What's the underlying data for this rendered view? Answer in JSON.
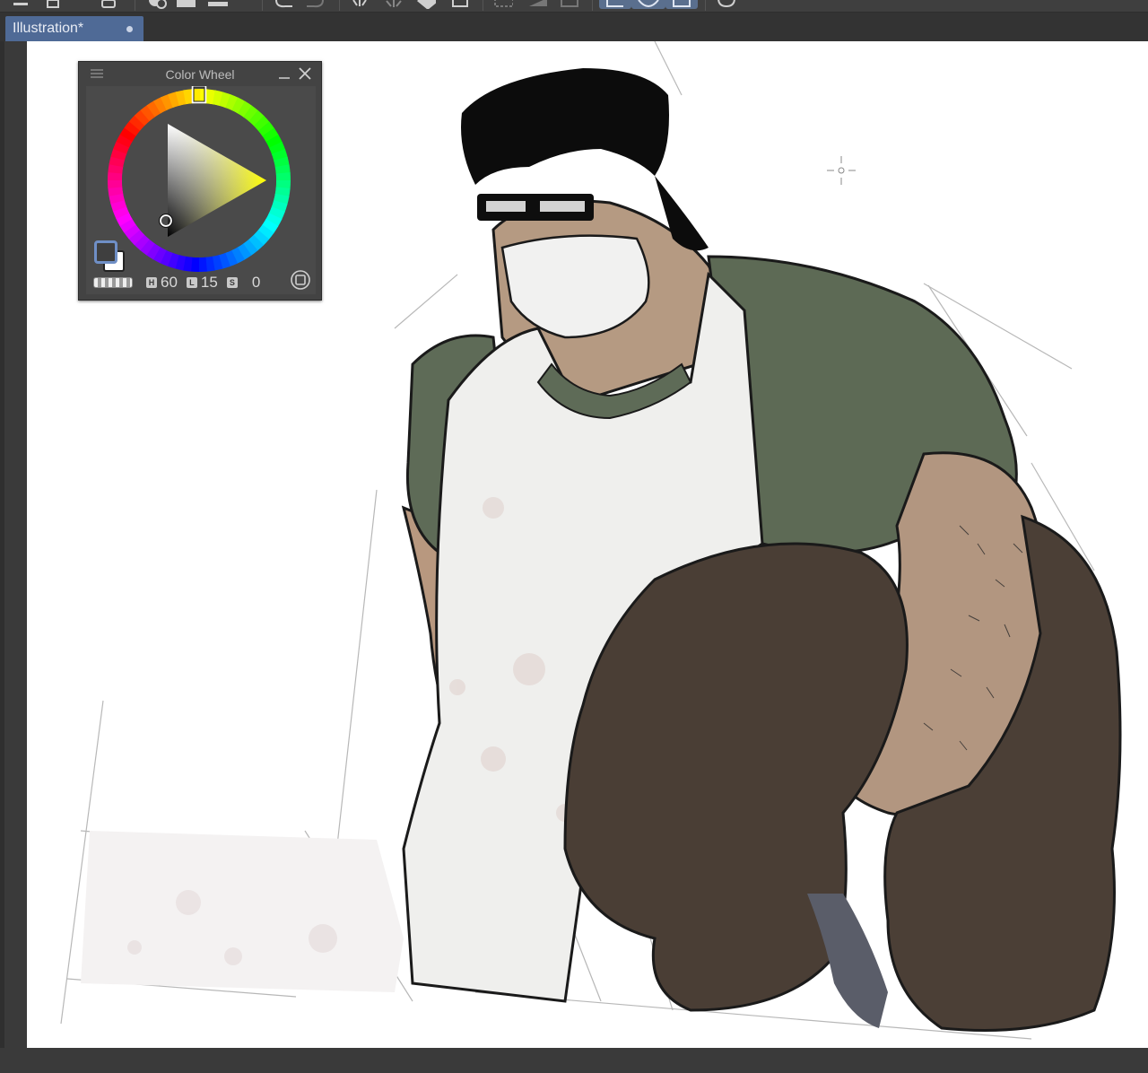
{
  "toolbar": {
    "icons": [
      "menu-icon",
      "new-file-icon",
      "save-icon",
      "add-layer-icon",
      "folder-icon",
      "layer-icon",
      "undo-icon",
      "redo-icon",
      "spinner-icon",
      "sparkle-icon",
      "fill-icon",
      "transform-icon",
      "selection-icon",
      "grid-icon",
      "layer-mask-icon",
      "lasso-icon",
      "rotate-icon",
      "crop-icon",
      "speech-bubble-icon"
    ]
  },
  "tab": {
    "title": "Illustration*"
  },
  "color_wheel": {
    "title": "Color Wheel",
    "hue_label": "H",
    "hue_value": "60",
    "lightness_label": "L",
    "lightness_value": "15",
    "saturation_label": "S",
    "saturation_value": "0",
    "selected_hue_deg": 60,
    "main_color": "#3f3f3f",
    "sub_color": "#ffffff"
  },
  "canvas": {
    "background": "#ffffff",
    "palette": {
      "hair": "#0d0d0d",
      "skin": "#b59a82",
      "shirt": "#5d6a55",
      "apron": "#eeeeec",
      "pants": "#4a3e35",
      "mask": "#f1f1f0"
    }
  }
}
